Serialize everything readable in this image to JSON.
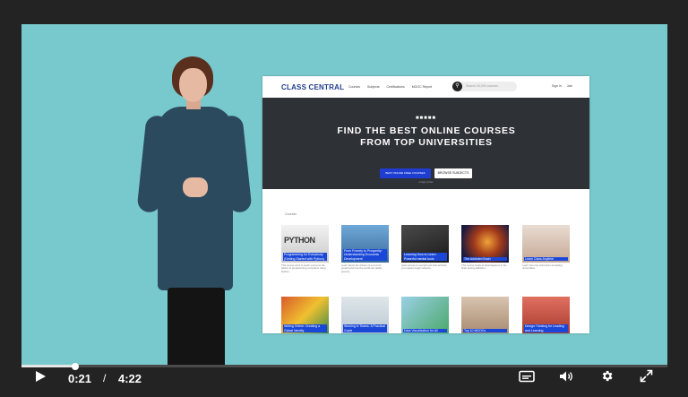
{
  "player": {
    "current_time": "0:21",
    "separator": "/",
    "duration": "4:22",
    "progress": 0.083,
    "colors": {
      "background": "#232323",
      "stage": "#78c9cd",
      "progress": "#e6e6e6"
    }
  },
  "site": {
    "logo": "CLASS CENTRAL",
    "nav": [
      "Courses",
      "Subjects",
      "Certifications",
      "MOOC Report"
    ],
    "search_placeholder": "Search 30,000 courses",
    "auth": [
      "Sign in",
      "Join"
    ],
    "hero_title": "FIND THE BEST ONLINE COURSES FROM TOP UNIVERSITIES",
    "btn_primary": "BEST ONLINE FREE COURSES",
    "btn_secondary": "BROWSE SUBJECTS",
    "hero_subtitle": "or sign up free",
    "section_label": "Courses",
    "cards": [
      {
        "caption": "Programming for Everybody (Getting Started with Python)",
        "desc": "This course aims to teach everyone the basics of programming computers using Python."
      },
      {
        "caption": "From Poverty to Prosperity: Understanding Economic Development",
        "desc": "Learn about the drivers of economic growth and how the world can tackle poverty."
      },
      {
        "caption": "Learning How to Learn: Powerful mental tools",
        "desc": "Gain access to mental tools that will help you master tough subjects."
      },
      {
        "caption": "The Addicted Brain",
        "desc": "This course looks at what happens in the brain during addiction."
      },
      {
        "caption": "Learn Class Anytime",
        "desc": "Learn from top instructors at leading universities."
      },
      {
        "caption": "Writing Online: Creating a Global Identity",
        "desc": ""
      },
      {
        "caption": "Working in Teams: A Practical Guide",
        "desc": ""
      },
      {
        "caption": "Data Visualization for All",
        "desc": ""
      },
      {
        "caption": "Top 10 MOOCs",
        "desc": ""
      },
      {
        "caption": "Design Thinking for Leading and Learning",
        "desc": ""
      }
    ]
  },
  "icons": {
    "play": "play-icon",
    "captions": "captions-icon",
    "volume": "volume-icon",
    "settings": "gear-icon",
    "fullscreen": "fullscreen-icon"
  }
}
